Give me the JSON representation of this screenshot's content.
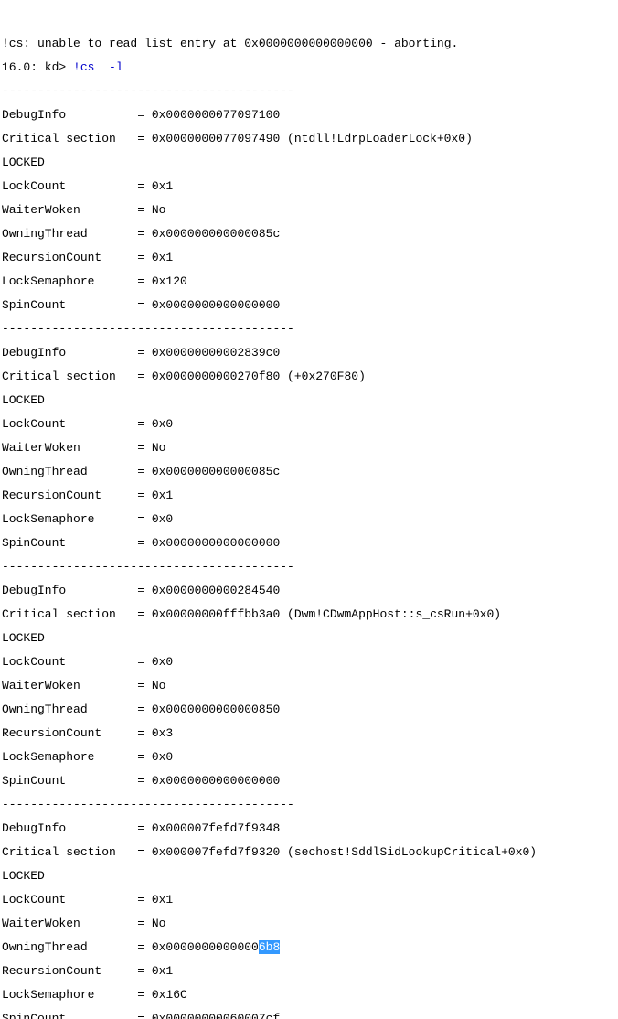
{
  "header": {
    "err_prefix": "!cs: ",
    "err_text": "unable to read list entry at 0x0000000000000000 - aborting.",
    "prompt": "16.0: kd> ",
    "bang": "!cs",
    "sp": "  ",
    "flag": "-l"
  },
  "sep": "-----------------------------------------",
  "fields_pad": {
    "DebugInfo": "DebugInfo          = ",
    "CriticalSection": "Critical section   = ",
    "LOCKED": "LOCKED",
    "LockCount": "LockCount          = ",
    "WaiterWoken": "WaiterWoken        = ",
    "OwningThread": "OwningThread       = ",
    "RecursionCount": "RecursionCount     = ",
    "LockSemaphore": "LockSemaphore      = ",
    "SpinCount": "SpinCount          = "
  },
  "sections": [
    {
      "DebugInfo": "0x0000000077097100",
      "CriticalSection": "0x0000000077097490 (ntdll!LdrpLoaderLock+0x0)",
      "LockCount": "0x1",
      "WaiterWoken": "No",
      "OwningThread": "0x000000000000085c",
      "RecursionCount": "0x1",
      "LockSemaphore": "0x120",
      "SpinCount": "0x0000000000000000"
    },
    {
      "DebugInfo": "0x00000000002839c0",
      "CriticalSection": "0x0000000000270f80 (+0x270F80)",
      "LockCount": "0x0",
      "WaiterWoken": "No",
      "OwningThread": "0x000000000000085c",
      "RecursionCount": "0x1",
      "LockSemaphore": "0x0",
      "SpinCount": "0x0000000000000000"
    },
    {
      "DebugInfo": "0x0000000000284540",
      "CriticalSection": "0x00000000fffbb3a0 (Dwm!CDwmAppHost::s_csRun+0x0)",
      "LockCount": "0x0",
      "WaiterWoken": "No",
      "OwningThread": "0x0000000000000850",
      "RecursionCount": "0x3",
      "LockSemaphore": "0x0",
      "SpinCount": "0x0000000000000000"
    },
    {
      "DebugInfo": "0x000007fefd7f9348",
      "CriticalSection": "0x000007fefd7f9320 (sechost!SddlSidLookupCritical+0x0)",
      "LockCount": "0x1",
      "WaiterWoken": "No",
      "OwningThread_pre": "0x0000000000000",
      "OwningThread_hl": "6b8",
      "RecursionCount": "0x1",
      "LockSemaphore": "0x16C",
      "SpinCount": "0x00000000060007cf"
    }
  ]
}
